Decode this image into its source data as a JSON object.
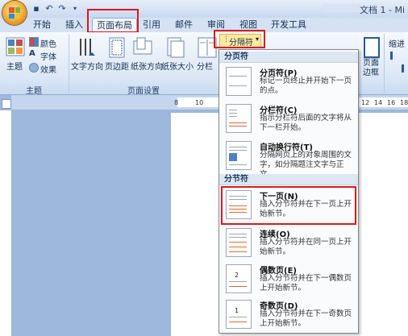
{
  "window": {
    "title": "文档 1 - Mi"
  },
  "tabs": [
    "开始",
    "插入",
    "页面布局",
    "引用",
    "邮件",
    "审阅",
    "视图",
    "开发工具"
  ],
  "ribbon": {
    "theme_group": {
      "label": "主题",
      "theme_button": "主题",
      "colors": "颜色",
      "fonts": "字体",
      "effects": "效果"
    },
    "page_setup_group": {
      "label": "页面设置",
      "text_direction": "文字方向",
      "margins": "页边距",
      "orientation": "纸张方向",
      "size": "纸张大小",
      "columns": "分栏"
    },
    "breaks_button": "分隔符",
    "page_background": "页面\n边框",
    "paragraph_indent": "缩进"
  },
  "ruler": {
    "marks": [
      "8",
      "10",
      "12",
      "14",
      "16",
      "18"
    ]
  },
  "breaks_menu": {
    "page_breaks_header": "分页符",
    "section_breaks_header": "分节符",
    "items": [
      {
        "title": "分页符(P)",
        "desc": "标记一页终止并开始下一页的点。"
      },
      {
        "title": "分栏符(C)",
        "desc": "指示分栏符后面的文字将从下一栏开始。"
      },
      {
        "title": "自动换行符(T)",
        "desc": "分隔网页上的对象周围的文字，如分隔题注文字与正文。"
      },
      {
        "title": "下一页(N)",
        "desc": "插入分节符并在下一页上开始新节。"
      },
      {
        "title": "连续(O)",
        "desc": "插入分节符并在同一页上开始新节。"
      },
      {
        "title": "偶数页(E)",
        "desc": "插入分节符并在下一偶数页上开始新节。"
      },
      {
        "title": "奇数页(D)",
        "desc": "插入分节符并在下一奇数页上开始新节。"
      }
    ]
  },
  "colors": {
    "highlight": "#e0161c",
    "accent": "#2b579a"
  },
  "icons": [
    "office-button",
    "save-icon",
    "undo-icon",
    "redo-icon",
    "dropdown-arrow-icon"
  ]
}
